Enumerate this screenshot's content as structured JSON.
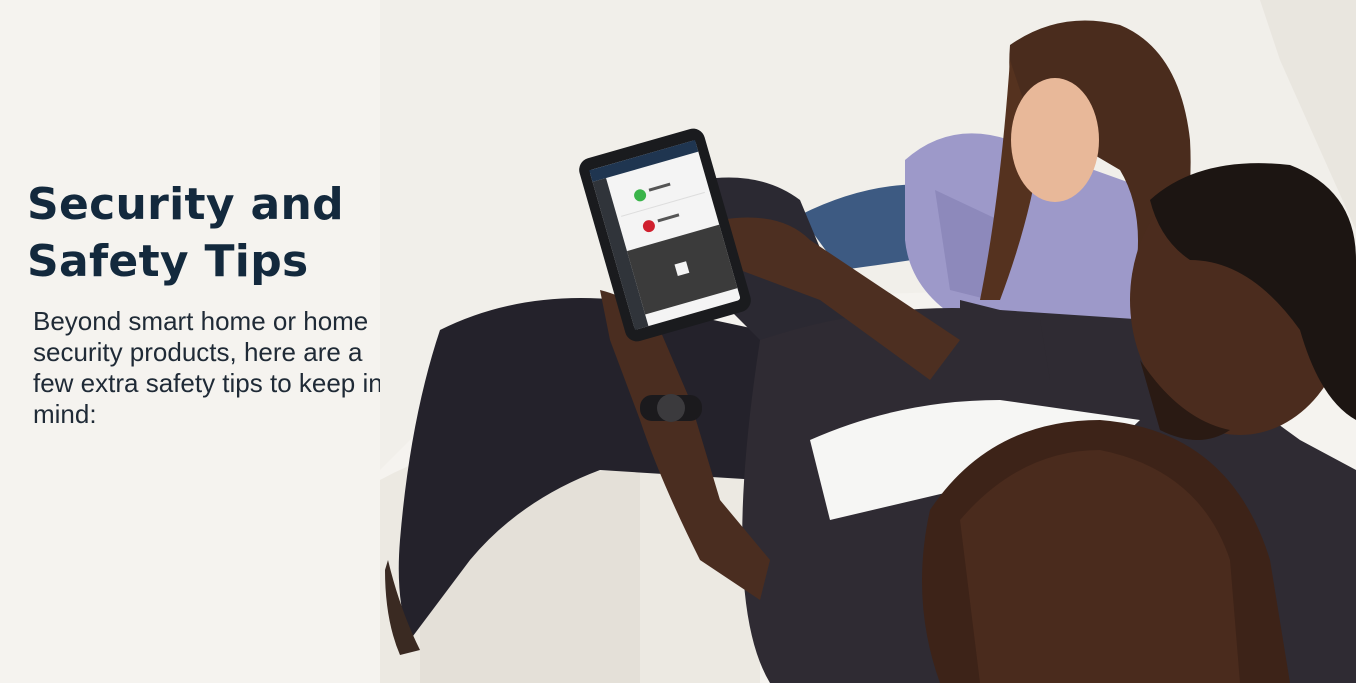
{
  "hero": {
    "title_line1": "Security and",
    "title_line2": "Safety Tips",
    "description": "Beyond smart home or home security products, here are a few extra safety tips to keep in mind:"
  },
  "photo": {
    "icon": "family-with-tablet-photo"
  },
  "colors": {
    "background": "#f5f3ef",
    "title": "#13293d",
    "body": "#1f2a36"
  }
}
